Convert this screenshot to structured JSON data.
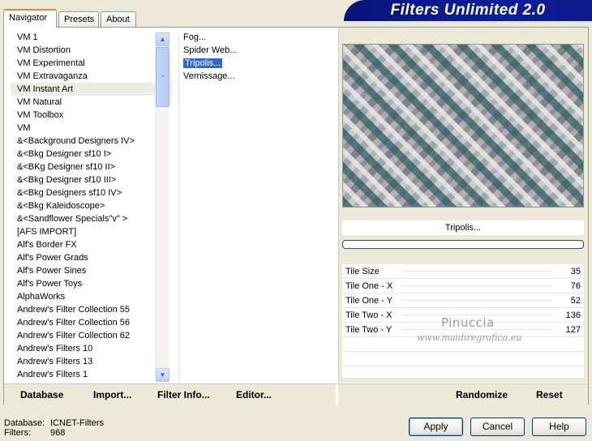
{
  "tabs": [
    "Navigator",
    "Presets",
    "About"
  ],
  "banner_title": "Filters Unlimited 2.0",
  "categories": [
    {
      "label": "VM 1"
    },
    {
      "label": "VM Distortion"
    },
    {
      "label": "VM Experimental"
    },
    {
      "label": "VM Extravaganza"
    },
    {
      "label": "VM Instant Art",
      "selected": true
    },
    {
      "label": "VM Natural"
    },
    {
      "label": "VM Toolbox"
    },
    {
      "label": "VM"
    },
    {
      "label": "&<Background Designers IV>"
    },
    {
      "label": "&<Bkg Designer sf10 I>"
    },
    {
      "label": "&<BKg Designer sf10 II>"
    },
    {
      "label": "&<Bkg Designer sf10 III>"
    },
    {
      "label": "&<Bkg Designers sf10 IV>"
    },
    {
      "label": "&<Bkg Kaleidoscope>"
    },
    {
      "label": "&<Sandflower Specials\"v\" >"
    },
    {
      "label": "[AFS IMPORT]"
    },
    {
      "label": "Alf's Border FX"
    },
    {
      "label": "Alf's Power Grads"
    },
    {
      "label": "Alf's Power Sines"
    },
    {
      "label": "Alf's Power Toys"
    },
    {
      "label": "AlphaWorks"
    },
    {
      "label": "Andrew's Filter Collection 55"
    },
    {
      "label": "Andrew's Filter Collection 56"
    },
    {
      "label": "Andrew's Filter Collection 62"
    },
    {
      "label": "Andrew's Filters 10"
    },
    {
      "label": "Andrew's Filters 13"
    },
    {
      "label": "Andrew's Filters 1"
    }
  ],
  "filters": [
    {
      "label": "Fog..."
    },
    {
      "label": "Spider Web..."
    },
    {
      "label": "Tripolis...",
      "selected": true
    },
    {
      "label": "Vernissage..."
    }
  ],
  "preview_filter_name": "Tripolis...",
  "params": [
    {
      "label": "Tile Size",
      "value": "35"
    },
    {
      "label": "Tile One - X",
      "value": "76"
    },
    {
      "label": "Tile One - Y",
      "value": "52"
    },
    {
      "label": "Tile Two - X",
      "value": "136"
    },
    {
      "label": "Tile Two - Y",
      "value": "127"
    }
  ],
  "watermark": {
    "name": "Pinuccia",
    "url": "www.maidiregrafica.eu"
  },
  "bottom_buttons": {
    "database": "Database",
    "import": "Import...",
    "filter_info": "Filter Info...",
    "editor": "Editor...",
    "randomize": "Randomize",
    "reset": "Reset"
  },
  "status": {
    "database_label": "Database:",
    "database_value": "ICNET-Filters",
    "filters_label": "Filters:",
    "filters_value": "968"
  },
  "dialog_buttons": {
    "apply": "Apply",
    "cancel": "Cancel",
    "help": "Help"
  }
}
